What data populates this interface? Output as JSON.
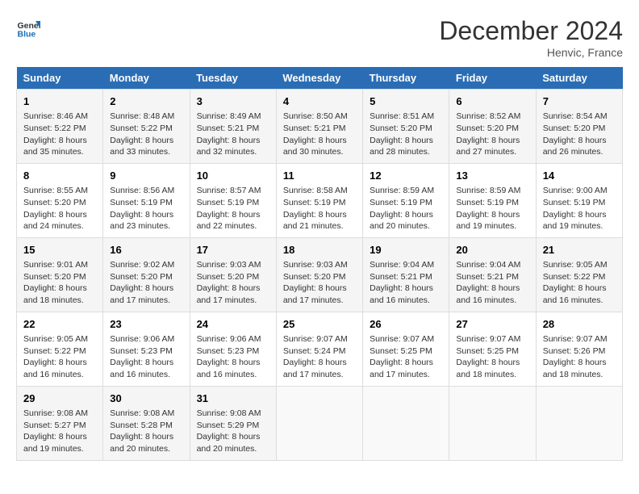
{
  "logo": {
    "line1": "General",
    "line2": "Blue"
  },
  "title": "December 2024",
  "location": "Henvic, France",
  "days_of_week": [
    "Sunday",
    "Monday",
    "Tuesday",
    "Wednesday",
    "Thursday",
    "Friday",
    "Saturday"
  ],
  "weeks": [
    [
      {
        "day": "1",
        "sunrise": "8:46 AM",
        "sunset": "5:22 PM",
        "daylight": "8 hours and 35 minutes."
      },
      {
        "day": "2",
        "sunrise": "8:48 AM",
        "sunset": "5:22 PM",
        "daylight": "8 hours and 33 minutes."
      },
      {
        "day": "3",
        "sunrise": "8:49 AM",
        "sunset": "5:21 PM",
        "daylight": "8 hours and 32 minutes."
      },
      {
        "day": "4",
        "sunrise": "8:50 AM",
        "sunset": "5:21 PM",
        "daylight": "8 hours and 30 minutes."
      },
      {
        "day": "5",
        "sunrise": "8:51 AM",
        "sunset": "5:20 PM",
        "daylight": "8 hours and 28 minutes."
      },
      {
        "day": "6",
        "sunrise": "8:52 AM",
        "sunset": "5:20 PM",
        "daylight": "8 hours and 27 minutes."
      },
      {
        "day": "7",
        "sunrise": "8:54 AM",
        "sunset": "5:20 PM",
        "daylight": "8 hours and 26 minutes."
      }
    ],
    [
      {
        "day": "8",
        "sunrise": "8:55 AM",
        "sunset": "5:20 PM",
        "daylight": "8 hours and 24 minutes."
      },
      {
        "day": "9",
        "sunrise": "8:56 AM",
        "sunset": "5:19 PM",
        "daylight": "8 hours and 23 minutes."
      },
      {
        "day": "10",
        "sunrise": "8:57 AM",
        "sunset": "5:19 PM",
        "daylight": "8 hours and 22 minutes."
      },
      {
        "day": "11",
        "sunrise": "8:58 AM",
        "sunset": "5:19 PM",
        "daylight": "8 hours and 21 minutes."
      },
      {
        "day": "12",
        "sunrise": "8:59 AM",
        "sunset": "5:19 PM",
        "daylight": "8 hours and 20 minutes."
      },
      {
        "day": "13",
        "sunrise": "8:59 AM",
        "sunset": "5:19 PM",
        "daylight": "8 hours and 19 minutes."
      },
      {
        "day": "14",
        "sunrise": "9:00 AM",
        "sunset": "5:19 PM",
        "daylight": "8 hours and 19 minutes."
      }
    ],
    [
      {
        "day": "15",
        "sunrise": "9:01 AM",
        "sunset": "5:20 PM",
        "daylight": "8 hours and 18 minutes."
      },
      {
        "day": "16",
        "sunrise": "9:02 AM",
        "sunset": "5:20 PM",
        "daylight": "8 hours and 17 minutes."
      },
      {
        "day": "17",
        "sunrise": "9:03 AM",
        "sunset": "5:20 PM",
        "daylight": "8 hours and 17 minutes."
      },
      {
        "day": "18",
        "sunrise": "9:03 AM",
        "sunset": "5:20 PM",
        "daylight": "8 hours and 17 minutes."
      },
      {
        "day": "19",
        "sunrise": "9:04 AM",
        "sunset": "5:21 PM",
        "daylight": "8 hours and 16 minutes."
      },
      {
        "day": "20",
        "sunrise": "9:04 AM",
        "sunset": "5:21 PM",
        "daylight": "8 hours and 16 minutes."
      },
      {
        "day": "21",
        "sunrise": "9:05 AM",
        "sunset": "5:22 PM",
        "daylight": "8 hours and 16 minutes."
      }
    ],
    [
      {
        "day": "22",
        "sunrise": "9:05 AM",
        "sunset": "5:22 PM",
        "daylight": "8 hours and 16 minutes."
      },
      {
        "day": "23",
        "sunrise": "9:06 AM",
        "sunset": "5:23 PM",
        "daylight": "8 hours and 16 minutes."
      },
      {
        "day": "24",
        "sunrise": "9:06 AM",
        "sunset": "5:23 PM",
        "daylight": "8 hours and 16 minutes."
      },
      {
        "day": "25",
        "sunrise": "9:07 AM",
        "sunset": "5:24 PM",
        "daylight": "8 hours and 17 minutes."
      },
      {
        "day": "26",
        "sunrise": "9:07 AM",
        "sunset": "5:25 PM",
        "daylight": "8 hours and 17 minutes."
      },
      {
        "day": "27",
        "sunrise": "9:07 AM",
        "sunset": "5:25 PM",
        "daylight": "8 hours and 18 minutes."
      },
      {
        "day": "28",
        "sunrise": "9:07 AM",
        "sunset": "5:26 PM",
        "daylight": "8 hours and 18 minutes."
      }
    ],
    [
      {
        "day": "29",
        "sunrise": "9:08 AM",
        "sunset": "5:27 PM",
        "daylight": "8 hours and 19 minutes."
      },
      {
        "day": "30",
        "sunrise": "9:08 AM",
        "sunset": "5:28 PM",
        "daylight": "8 hours and 20 minutes."
      },
      {
        "day": "31",
        "sunrise": "9:08 AM",
        "sunset": "5:29 PM",
        "daylight": "8 hours and 20 minutes."
      },
      null,
      null,
      null,
      null
    ]
  ],
  "labels": {
    "sunrise": "Sunrise:",
    "sunset": "Sunset:",
    "daylight": "Daylight:"
  }
}
